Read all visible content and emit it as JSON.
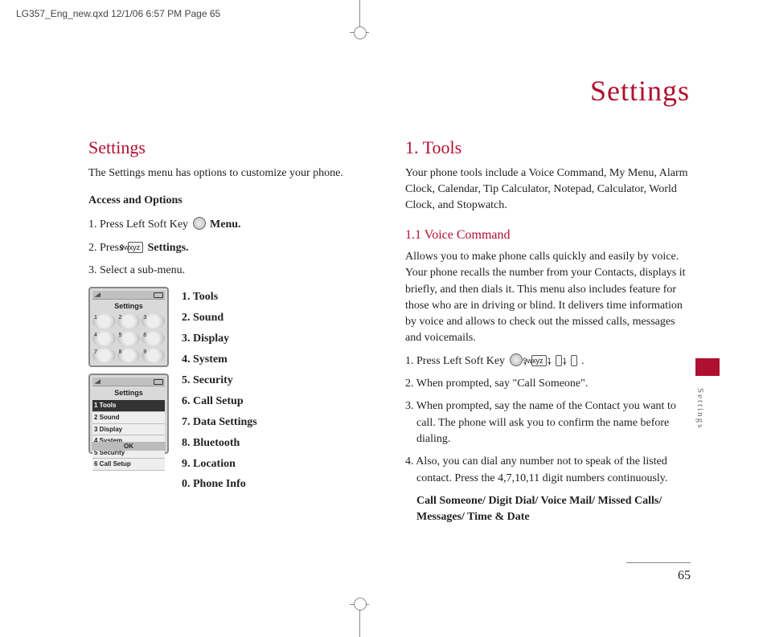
{
  "header_meta": "LG357_Eng_new.qxd  12/1/06  6:57 PM  Page 65",
  "page_title": "Settings",
  "side_tab": "Settings",
  "page_number": "65",
  "left": {
    "heading": "Settings",
    "intro": "The Settings menu has options to customize your phone.",
    "access_heading": "Access and Options",
    "step1_pre": "1. Press Left Soft Key ",
    "step1_post": " Menu.",
    "step2_pre": "2. Press ",
    "step2_key": "9wxyz",
    "step2_post": " Settings.",
    "step3": "3. Select a sub-menu.",
    "menu_items": {
      "i1": "1.  Tools",
      "i2": "2.  Sound",
      "i3": "3.  Display",
      "i4": "4.  System",
      "i5": "5.  Security",
      "i6": "6.  Call Setup",
      "i7": "7.  Data Settings",
      "i8": "8.  Bluetooth",
      "i9": "9.  Location",
      "i0": "0. Phone Info"
    },
    "screen1": {
      "title": "Settings",
      "g1": "1",
      "g2": "2",
      "g3": "3",
      "g4": "4",
      "g5": "5",
      "g6": "6",
      "g7": "7",
      "g8": "8",
      "g9": "9"
    },
    "screen2": {
      "title": "Settings",
      "r1": "1 Tools",
      "r2": "2 Sound",
      "r3": "3 Display",
      "r4": "4 System",
      "r5": "5 Security",
      "r6": "6 Call Setup",
      "ok": "OK"
    }
  },
  "right": {
    "heading": "1. Tools",
    "intro": "Your phone tools include a Voice Command, My Menu, Alarm Clock, Calendar, Tip Calculator, Notepad, Calculator, World Clock, and Stopwatch.",
    "sub_heading": "1.1  Voice Command",
    "vc_desc": "Allows you to make phone calls quickly and easily by voice. Your phone recalls the number from your Contacts, displays it briefly, and then dials it. This menu also includes feature for those who are in driving or blind. It delivers time information by voice and allows to check out the missed calls, messages and voicemails.",
    "s1_pre": "1. Press Left Soft Key ",
    "s1_k2": "9wxyz",
    "s1_k3": "1   ",
    "s1_k4": "1   ",
    "s2": "2. When prompted, say \"Call Someone\".",
    "s3": "3. When prompted, say the name of the Contact you want to call. The phone will ask you to confirm the name before dialing.",
    "s4": "4. Also, you can dial any number not to speak of the listed contact. Press the 4,7,10,11 digit numbers continuously.",
    "options": "Call Someone/ Digit Dial/ Voice Mail/ Missed Calls/ Messages/ Time & Date"
  }
}
